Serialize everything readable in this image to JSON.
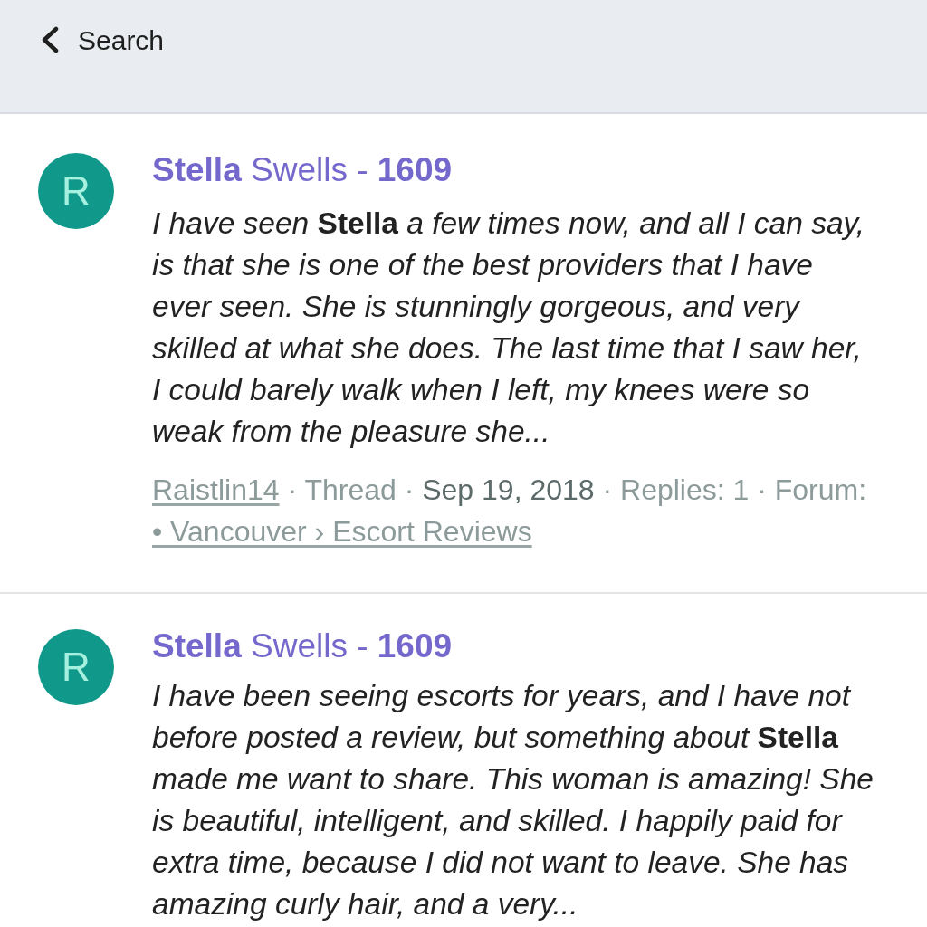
{
  "top_bar": {
    "back_label": "Search"
  },
  "results": [
    {
      "avatar": "R",
      "title": "**Stella** Swells - **1609**",
      "snippet": "I have seen **Stella** a few times now, and all I can say, is that she is one of the best providers that I have ever seen. She is stunningly gorgeous, and very skilled at what she does. The last time that I saw her, I could barely walk when I left, my knees were so weak from the pleasure she...",
      "meta": [
        {
          "kind": "author",
          "text": "Raistlin14"
        },
        {
          "kind": "plain",
          "text": " · Thread · "
        },
        {
          "kind": "date",
          "text": "Sep 19, 2018"
        },
        {
          "kind": "plain",
          "text": " · Replies: 1 · Forum: "
        },
        {
          "kind": "forum",
          "text": "• Vancouver › Escort Reviews"
        }
      ]
    },
    {
      "avatar": "R",
      "title": "**Stella** Swells - **1609**",
      "snippet": "I have been seeing escorts for years, and I have not before posted a review, but something about **Stella** made me want to share. This woman is amazing! She is beautiful, intelligent, and skilled. I happily paid for extra time, because I did not want to leave. She has amazing curly hair, and a very..."
    }
  ]
}
